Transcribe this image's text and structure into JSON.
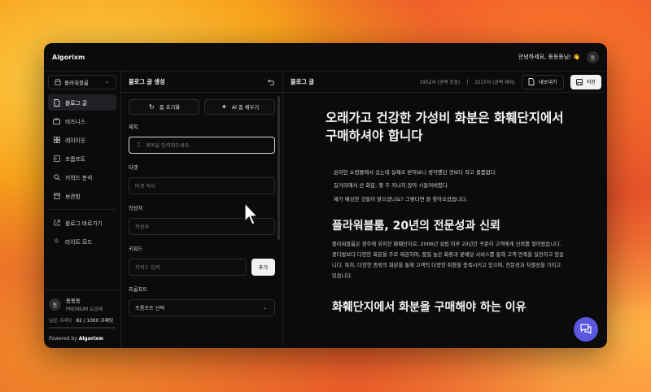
{
  "window": {
    "brand": "Algorixm",
    "greeting": "안녕하세요, 동동동님! 👋",
    "avatar_initial": "동"
  },
  "sidebar": {
    "workspace": "플라워블룸",
    "items": [
      {
        "label": "블로그 글",
        "icon": "document-icon",
        "active": true
      },
      {
        "label": "비즈니스",
        "icon": "briefcase-icon",
        "active": false
      },
      {
        "label": "레이아웃",
        "icon": "layout-grid-icon",
        "active": false
      },
      {
        "label": "프롬프트",
        "icon": "prompt-icon",
        "active": false
      },
      {
        "label": "키워드 분석",
        "icon": "search-icon",
        "active": false
      },
      {
        "label": "보관함",
        "icon": "archive-icon",
        "active": false
      }
    ],
    "links": [
      {
        "label": "블로그 바로가기",
        "icon": "external-link-icon"
      },
      {
        "label": "라이트 모드",
        "icon": "sun-icon"
      }
    ],
    "user": {
      "initial": "동",
      "name": "동동동",
      "plan": "PREMIUM 요금제",
      "credit_label": "남은 크레딧",
      "credit_value": "82 / 1000 크레딧"
    },
    "powered_prefix": "Powered by",
    "powered_brand": "Algorixm"
  },
  "form": {
    "title": "블로그 글 생성",
    "reset_label": "폼 초기화",
    "ai_fill_label": "AI 폼 채우기",
    "fields": {
      "title_label": "제목",
      "title_placeholder": "제목을 입력해주세요.",
      "target_label": "타겟",
      "target_placeholder": "타겟 독자",
      "author_label": "작성자",
      "author_placeholder": "작성자",
      "keyword_label": "키워드",
      "keyword_placeholder": "키워드 입력",
      "keyword_add": "추가",
      "prompt_label": "프롬프트",
      "prompt_select": "프롬프트 선택"
    }
  },
  "content": {
    "title": "블로그 글",
    "count_with_space": "1952자 (공백 포함)",
    "count_sep": "|",
    "count_without_space": "1515자 (공백 제외)",
    "export_label": "내보내기",
    "save_label": "저장",
    "article": {
      "h1": "오래가고 건강한 가성비 화분은 화훼단지에서 구매하셔야 합니다",
      "intro": [
        "온라인 쇼핑몰에서 샀는데 실제로 받아보니 생각했던 것보다 작고 볼품없다.",
        "길거리에서 산 화분, 몇 주 지나지 않아 시들어버렸다.",
        "제가 예상한 것들이 맞으셨나요? 그렇다면 잘 찾아오셨습니다."
      ],
      "h2": "플라워블룸, 20년의 전문성과 신뢰",
      "para": "플라워블룸은 광주에 위치한 화훼단지로, 2006년 설립 이후 20년간 꾸준히 고객에게 신뢰를 쌓아왔습니다. 꽃다발보다 다양한 화분을 주로 제공하며, 품질 높은 화환과 꽃배달 서비스를 통해 고객 만족을 실현하고 있습니다. 특히, 다양한 종류의 화분을 통해 고객의 다양한 취향을 충족시키고 있으며, 전문성과 차별성을 가지고 있습니다.",
      "h2b": "화훼단지에서 화분을 구매해야 하는 이유"
    }
  },
  "colors": {
    "accent_chat": "#5a57e0",
    "window_bg": "#0b0b0c"
  }
}
